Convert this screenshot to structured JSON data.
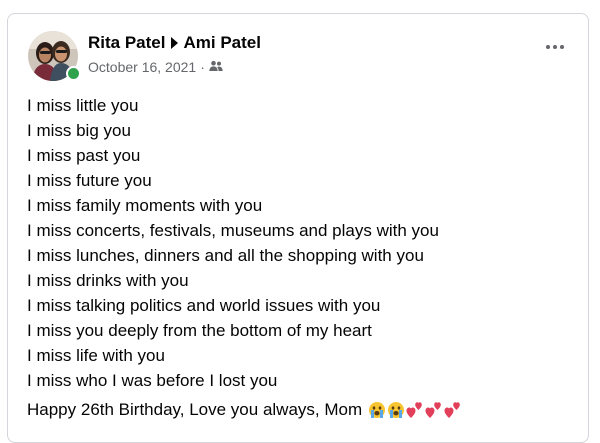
{
  "post": {
    "author": "Rita Patel",
    "recipient": "Ami Patel",
    "date": "October 16, 2021",
    "separator": "·",
    "audience_icon": "friends-icon",
    "lines": [
      "I miss little you",
      "I miss big you",
      "I miss past you",
      "I miss future you",
      "I miss family moments with you",
      "I miss concerts, festivals, museums and plays with you",
      "I miss lunches, dinners and all the shopping with you",
      "I miss drinks with you",
      "I miss talking politics and world issues with you",
      "I miss you deeply from the bottom of my heart",
      "I miss life with you",
      "I miss who I was before I lost you"
    ],
    "closing": "Happy 26th Birthday, Love you always, Mom",
    "emojis": [
      "crying-face-emoji",
      "crying-face-emoji",
      "two-hearts-emoji",
      "two-hearts-emoji",
      "two-hearts-emoji"
    ]
  },
  "colors": {
    "text": "#050505",
    "secondary": "#65676b",
    "online": "#31a24c",
    "border": "#d3d6db"
  }
}
